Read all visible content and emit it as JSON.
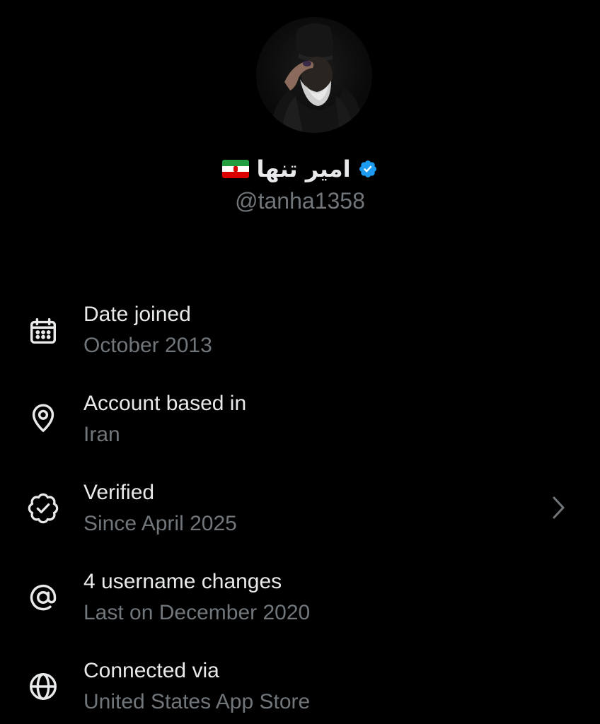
{
  "profile": {
    "display_name": "امیر تنها",
    "handle": "@tanha1358",
    "flag_icon": "iran-flag-icon",
    "verified_icon": "verified-badge-icon",
    "verified_color": "#1d9bf0"
  },
  "about": {
    "items": [
      {
        "icon": "calendar-icon",
        "title": "Date joined",
        "subtitle": "October 2013"
      },
      {
        "icon": "location-pin-icon",
        "title": "Account based in",
        "subtitle": "Iran"
      },
      {
        "icon": "verified-outline-icon",
        "title": "Verified",
        "subtitle": "Since April 2025",
        "chevron": "chevron-right-icon"
      },
      {
        "icon": "at-sign-icon",
        "title": "4 username changes",
        "subtitle": "Last on December 2020"
      },
      {
        "icon": "globe-icon",
        "title": "Connected via",
        "subtitle": "United States App Store"
      }
    ]
  },
  "colors": {
    "background": "#000000",
    "primary_text": "#e7e9ea",
    "secondary_text": "#71767b",
    "accent": "#1d9bf0"
  }
}
